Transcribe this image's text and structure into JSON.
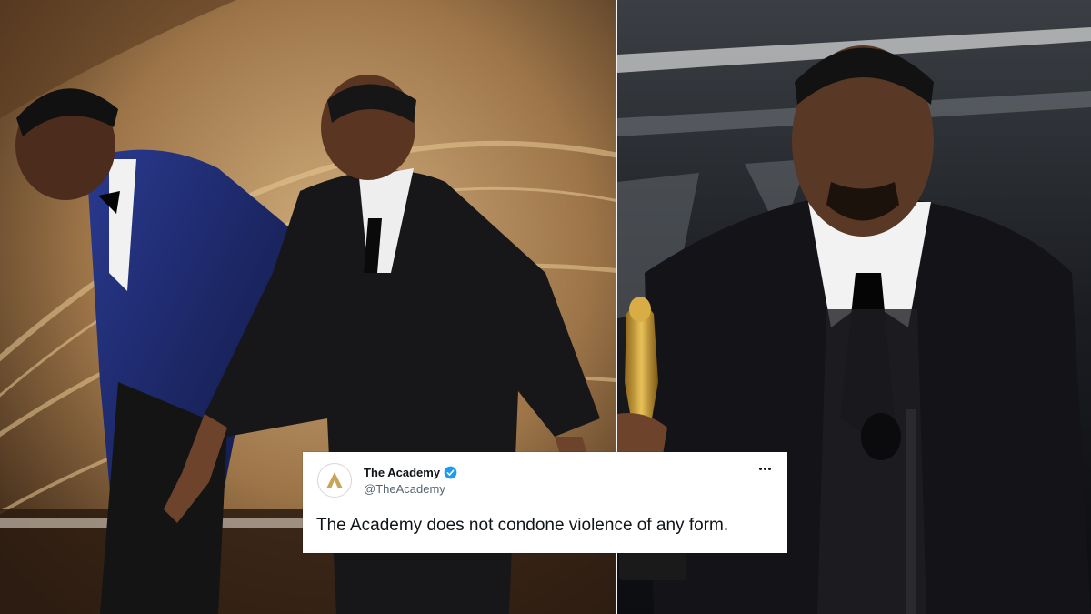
{
  "photos": {
    "left": {
      "subject": "stage-confrontation-photo"
    },
    "right": {
      "subject": "award-speech-photo"
    }
  },
  "tweet": {
    "display_name": "The Academy",
    "handle": "@TheAcademy",
    "text": "The Academy does not condone violence of any form.",
    "verified_color": "#1d9bf0",
    "avatar_icon": "academy-logo-icon",
    "menu_icon": "more-dots-icon"
  },
  "colors": {
    "stage_gold": "#b9925f",
    "velvet_blue": "#1f2a6b",
    "tux_black": "#17171a"
  }
}
